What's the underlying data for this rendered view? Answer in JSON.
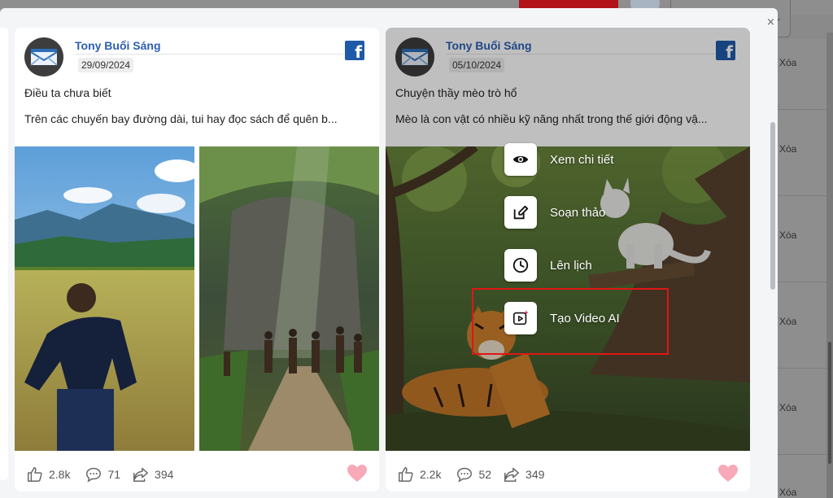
{
  "colors": {
    "author": "#2b5fb3",
    "facebook": "#1f5aa8",
    "heart": "#f7a9b8",
    "highlight": "#e01616"
  },
  "modal": {
    "close_glyph": "×"
  },
  "background": {
    "dropdown_chevron": "⌄",
    "delete_labels": [
      "Xóa",
      "Xóa",
      "Xóa",
      "Xóa",
      "Xóa",
      "Xóa"
    ]
  },
  "posts": [
    {
      "author": "Tony Buổi Sáng",
      "date": "29/09/2024",
      "title": "Điều ta chưa biết",
      "excerpt": "Trên các chuyến bay đường dài, tui hay đọc sách để quên b...",
      "platform_icon": "facebook-icon",
      "likes": "2.8k",
      "comments": "71",
      "shares": "394"
    },
    {
      "author": "Tony Buổi Sáng",
      "date": "05/10/2024",
      "title": "Chuyện thầy mèo trò hổ",
      "excerpt": "Mèo là con vật có nhiều kỹ năng nhất trong thế giới động vậ...",
      "platform_icon": "facebook-icon",
      "likes": "2.2k",
      "comments": "52",
      "shares": "349",
      "hover_menu": {
        "view": "Xem chi tiết",
        "edit": "Soạn thảo",
        "schedule": "Lên lịch",
        "ai_video": "Tạo Video AI"
      }
    }
  ]
}
